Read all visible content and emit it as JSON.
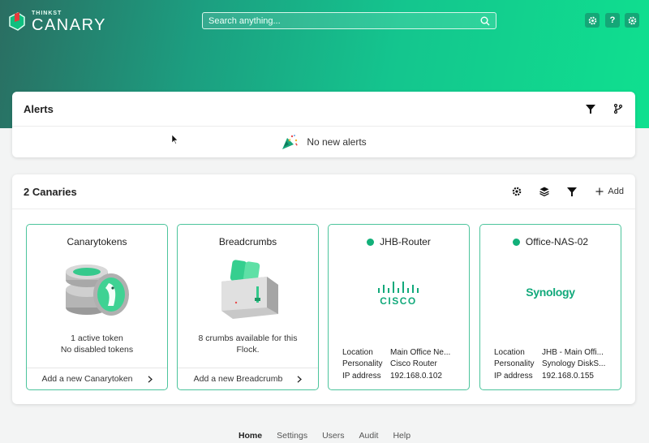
{
  "header": {
    "logo_top": "THINKST",
    "logo_main": "CANARY",
    "search_placeholder": "Search anything...",
    "help_label": "?",
    "accent": "#14c58e"
  },
  "alerts": {
    "title": "Alerts",
    "empty_text": "No new alerts"
  },
  "canaries": {
    "title": "2 Canaries",
    "add_label": "Add",
    "tiles": [
      {
        "title": "Canarytokens",
        "desc_line1": "1 active token",
        "desc_line2": "No disabled tokens",
        "footer": "Add a new Canarytoken"
      },
      {
        "title": "Breadcrumbs",
        "desc_line1": "8 crumbs available for this",
        "desc_line2": "Flock.",
        "footer": "Add a new Breadcrumb"
      },
      {
        "title": "JHB-Router",
        "brand": "CISCO",
        "info": [
          {
            "key": "Location",
            "value": "Main Office Ne..."
          },
          {
            "key": "Personality",
            "value": "Cisco Router"
          },
          {
            "key": "IP address",
            "value": "192.168.0.102"
          }
        ]
      },
      {
        "title": "Office-NAS-02",
        "brand": "Synology",
        "info": [
          {
            "key": "Location",
            "value": "JHB - Main Offi..."
          },
          {
            "key": "Personality",
            "value": "Synology DiskS..."
          },
          {
            "key": "IP address",
            "value": "192.168.0.155"
          }
        ]
      }
    ]
  },
  "nav": {
    "items": [
      "Home",
      "Settings",
      "Users",
      "Audit",
      "Help"
    ]
  }
}
